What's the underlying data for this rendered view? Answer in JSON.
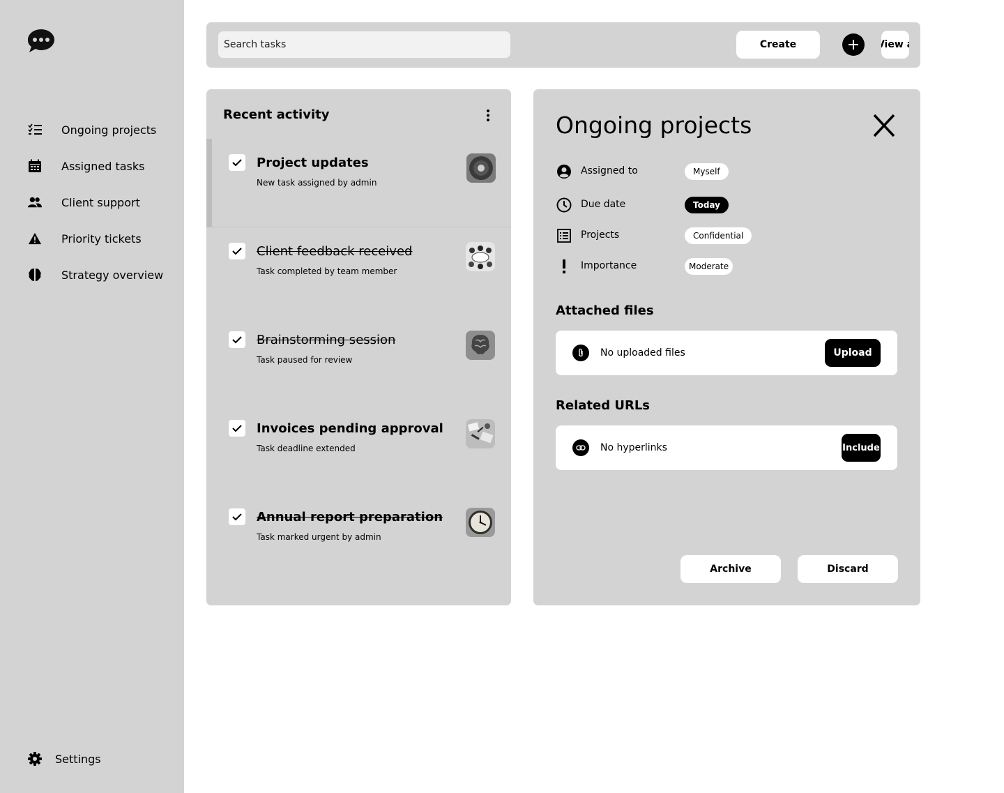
{
  "sidebar": {
    "logo_icon": "chat-bubble-icon",
    "items": [
      {
        "label": "Ongoing projects",
        "icon": "checklist-icon"
      },
      {
        "label": "Assigned tasks",
        "icon": "calendar-icon"
      },
      {
        "label": "Client support",
        "icon": "people-icon"
      },
      {
        "label": "Priority tickets",
        "icon": "warning-icon"
      },
      {
        "label": "Strategy overview",
        "icon": "brain-icon"
      }
    ],
    "settings_label": "Settings"
  },
  "topbar": {
    "search_value": "Search tasks",
    "create_label": "Create",
    "view_label": "View a"
  },
  "activity": {
    "title": "Recent activity",
    "items": [
      {
        "title": "Project updates",
        "subtitle": "New task assigned by admin",
        "checked": true
      },
      {
        "title": "Client feedback received",
        "subtitle": "Task completed by team member",
        "checked": true
      },
      {
        "title": "Brainstorming session",
        "subtitle": "Task paused for review",
        "checked": true
      },
      {
        "title": "Invoices pending approval",
        "subtitle": "Task deadline extended",
        "checked": true
      },
      {
        "title": "Annual report preparation",
        "subtitle": "Task marked urgent by admin",
        "checked": true
      }
    ]
  },
  "details": {
    "title": "Ongoing projects",
    "properties": [
      {
        "label": "Assigned to",
        "value": "Myself",
        "icon": "user-circle-icon"
      },
      {
        "label": "Due date",
        "value": "Today",
        "icon": "clock-icon"
      },
      {
        "label": "Projects",
        "value": "Confidential",
        "icon": "list-icon"
      },
      {
        "label": "Importance",
        "value": "Moderate",
        "icon": "exclamation-icon"
      }
    ],
    "attached_title": "Attached files",
    "attached_text": "No uploaded files",
    "upload_label": "Upload",
    "urls_title": "Related URLs",
    "urls_text": "No hyperlinks",
    "include_label": "Include",
    "archive_label": "Archive",
    "discard_label": "Discard"
  }
}
